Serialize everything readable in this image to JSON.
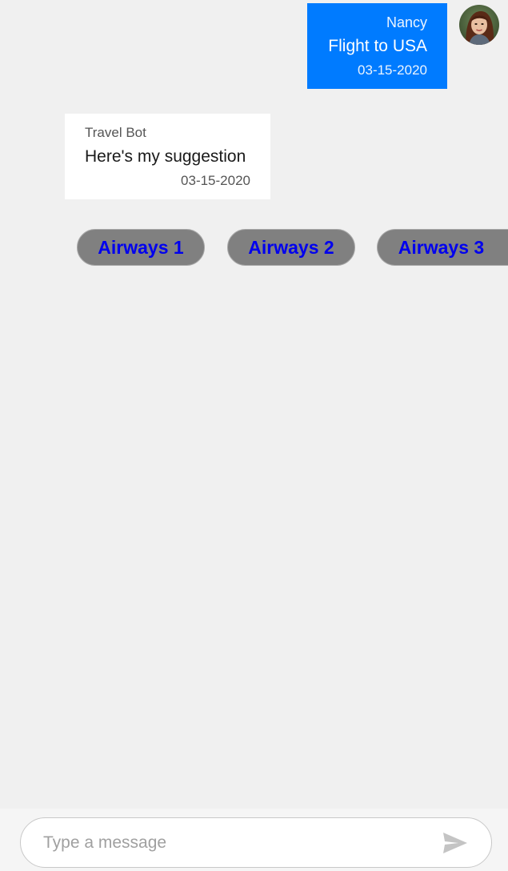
{
  "messages": {
    "outgoing": {
      "author": "Nancy",
      "text": "Flight to USA",
      "time": "03-15-2020"
    },
    "incoming": {
      "author": "Travel Bot",
      "text": "Here's my suggestion",
      "time": "03-15-2020"
    }
  },
  "suggested_actions": [
    {
      "label": "Airways 1"
    },
    {
      "label": "Airways 2"
    },
    {
      "label": "Airways 3"
    }
  ],
  "composer": {
    "placeholder": "Type a message",
    "send_icon": "send-icon"
  },
  "colors": {
    "background": "#f0f0f0",
    "outgoing_bubble": "#007bff",
    "incoming_bubble": "#ffffff",
    "action_button": "#808080",
    "action_text": "#0000ee"
  }
}
